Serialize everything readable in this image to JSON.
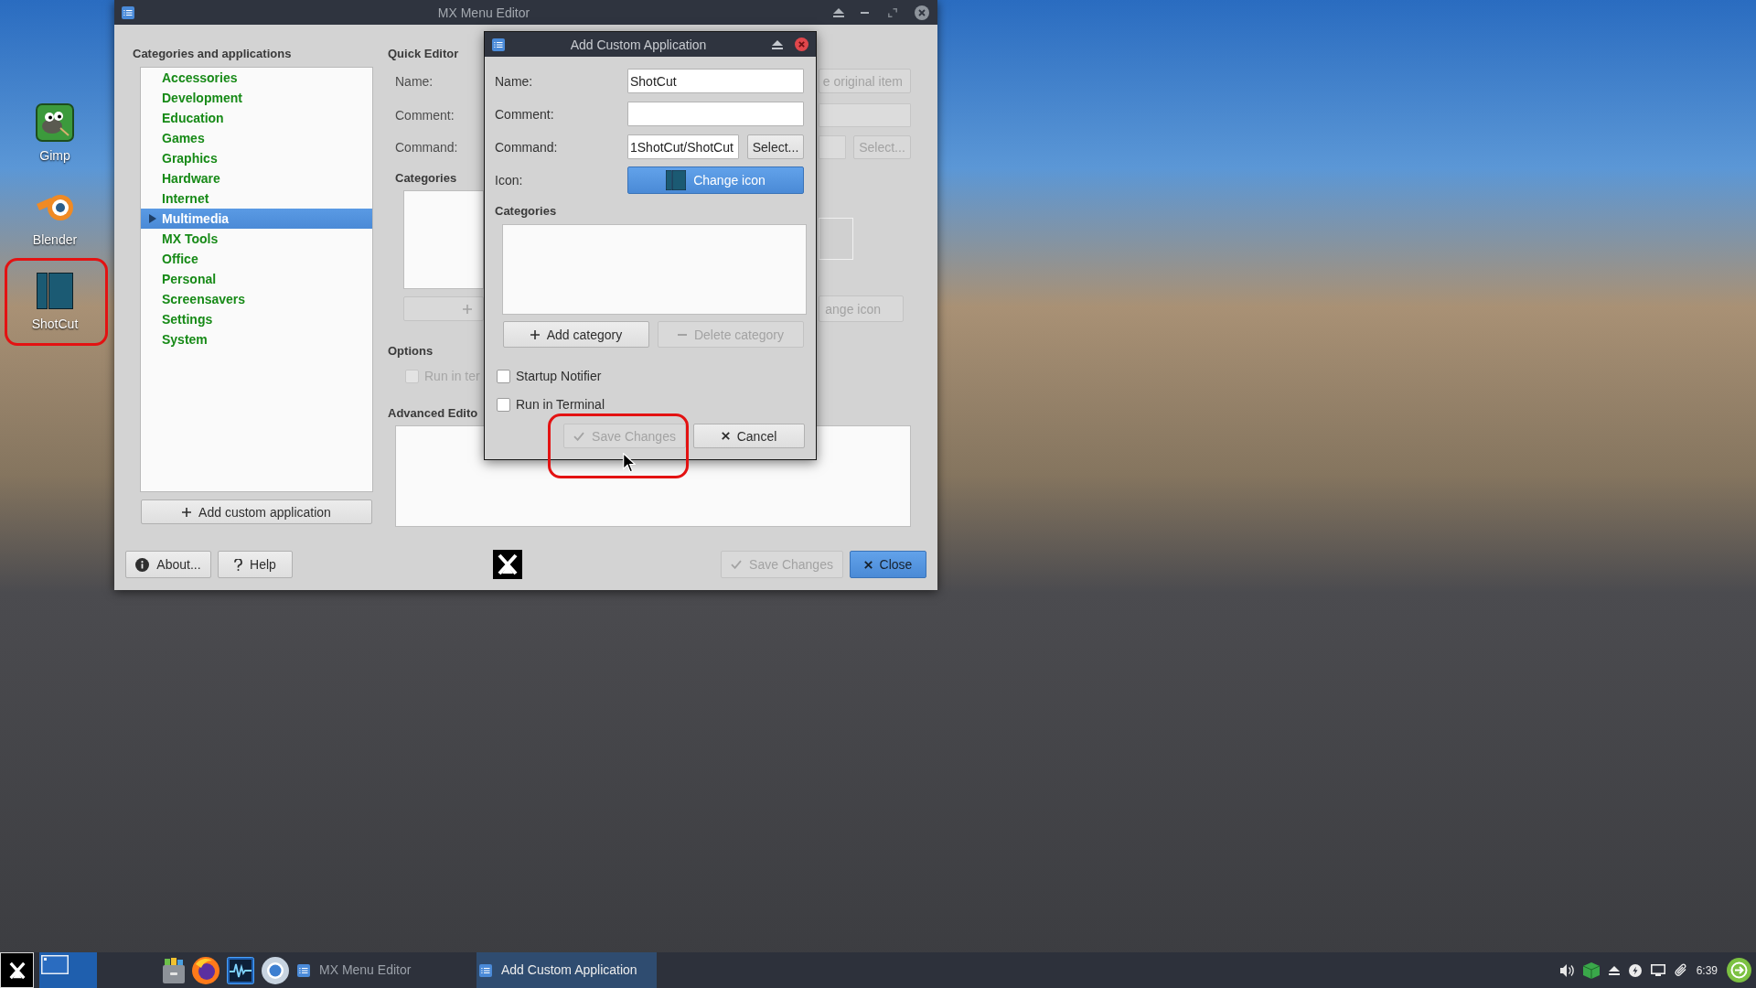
{
  "desktop": {
    "icons": [
      {
        "label": "Gimp"
      },
      {
        "label": "Blender"
      },
      {
        "label": "ShotCut"
      }
    ]
  },
  "main_window": {
    "title": "MX Menu Editor",
    "categories": {
      "title": "Categories and applications",
      "items": [
        {
          "label": "Accessories",
          "selected": false
        },
        {
          "label": "Development",
          "selected": false
        },
        {
          "label": "Education",
          "selected": false
        },
        {
          "label": "Games",
          "selected": false
        },
        {
          "label": "Graphics",
          "selected": false
        },
        {
          "label": "Hardware",
          "selected": false
        },
        {
          "label": "Internet",
          "selected": false
        },
        {
          "label": "Multimedia",
          "selected": true
        },
        {
          "label": "MX Tools",
          "selected": false
        },
        {
          "label": "Office",
          "selected": false
        },
        {
          "label": "Personal",
          "selected": false
        },
        {
          "label": "Screensavers",
          "selected": false
        },
        {
          "label": "Settings",
          "selected": false
        },
        {
          "label": "System",
          "selected": false
        }
      ]
    },
    "add_custom_button": "Add custom application",
    "quick_editor": {
      "title": "Quick Editor",
      "disabled": true,
      "name_label": "Name:",
      "restore_button": "e original item",
      "comment_label": "Comment:",
      "command_label": "Command:",
      "select_button": "Select...",
      "categories_label": "Categories",
      "icon_button": "ange icon"
    },
    "options": {
      "title": "Options",
      "checkboxes": [
        {
          "label": "Run in ter",
          "checked": false,
          "disabled": true
        }
      ]
    },
    "advanced_editor": {
      "title": "Advanced Edito"
    },
    "buttons": [
      {
        "label": "About...",
        "kind": "about",
        "disabled": false,
        "default": false
      },
      {
        "label": "Help",
        "kind": "help",
        "disabled": false,
        "default": false
      },
      {
        "label": "Save Changes",
        "kind": "save",
        "disabled": true,
        "default": false
      },
      {
        "label": "Close",
        "kind": "close",
        "disabled": false,
        "default": true
      }
    ]
  },
  "dialog": {
    "title": "Add Custom Application",
    "fields": [
      {
        "label": "Name:",
        "kind": "text",
        "value": "ShotCut"
      },
      {
        "label": "Comment:",
        "kind": "text"
      },
      {
        "label": "Command:",
        "kind": "file",
        "value": "1ShotCut/ShotCut",
        "button": "Select..."
      },
      {
        "label": "Icon:",
        "kind": "icon",
        "button": "Change icon"
      }
    ],
    "categories_label": "Categories",
    "category_buttons": [
      {
        "label": "Add category",
        "kind": "add",
        "disabled": false
      },
      {
        "label": "Delete category",
        "kind": "delete",
        "disabled": true
      }
    ],
    "checkboxes": [
      {
        "label": "Startup Notifier",
        "checked": false
      },
      {
        "label": "Run in Terminal",
        "checked": false
      }
    ],
    "buttons": [
      {
        "label": "Save Changes",
        "kind": "save",
        "disabled": true
      },
      {
        "label": "Cancel",
        "kind": "cancel",
        "disabled": false
      }
    ]
  },
  "taskbar": {
    "tasks": [
      {
        "label": "MX Menu Editor",
        "selected": false
      },
      {
        "label": "Add Custom Application",
        "selected": true
      }
    ],
    "clock": "6:39"
  }
}
